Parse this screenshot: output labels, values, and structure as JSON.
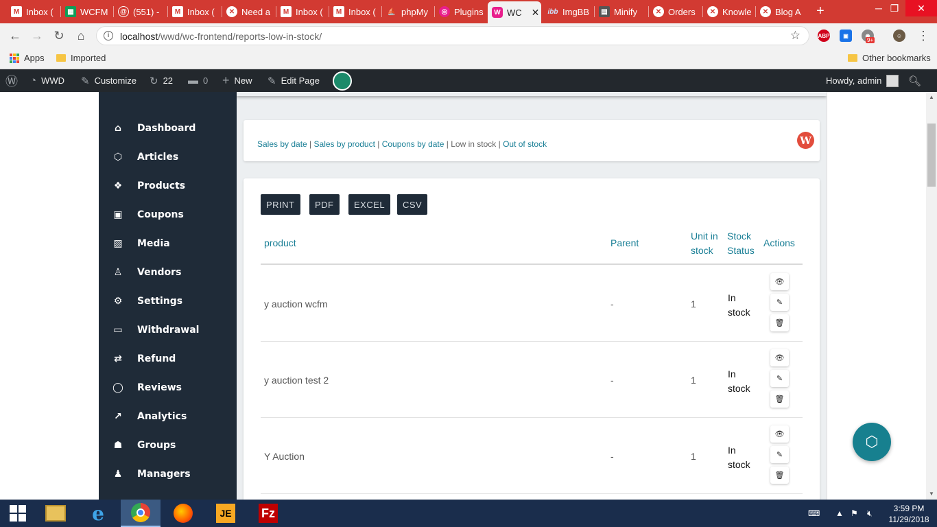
{
  "browser": {
    "tabs": [
      {
        "label": "Inbox (",
        "icon": "gmail-icon",
        "color": "#ffffff"
      },
      {
        "label": "WCFM",
        "icon": "sheets-icon",
        "color": "#0f9d58"
      },
      {
        "label": "(551) -",
        "icon": "mail-icon",
        "color": "#ffffff"
      },
      {
        "label": "Inbox (",
        "icon": "gmail-icon",
        "color": "#ffffff"
      },
      {
        "label": "Need a",
        "icon": "x-icon",
        "color": "#ffffff"
      },
      {
        "label": "Inbox (",
        "icon": "gmail-icon",
        "color": "#ffffff"
      },
      {
        "label": "Inbox (",
        "icon": "gmail-icon",
        "color": "#ffffff"
      },
      {
        "label": "phpMy",
        "icon": "phpmyadmin-icon",
        "color": "#f2a200"
      },
      {
        "label": "Plugins",
        "icon": "plugins-icon",
        "color": "#e91e8c"
      },
      {
        "label": "WC",
        "icon": "wcfm-icon",
        "color": "#e91e8c"
      },
      {
        "label": "ImgBB",
        "icon": "imgbb-icon",
        "color": "#3a8ee6"
      },
      {
        "label": "Minify",
        "icon": "minify-icon",
        "color": "#555555"
      },
      {
        "label": "Orders",
        "icon": "x-icon",
        "color": "#ffffff"
      },
      {
        "label": "Knowle",
        "icon": "x-icon",
        "color": "#ffffff"
      },
      {
        "label": "Blog A",
        "icon": "x-icon",
        "color": "#ffffff"
      }
    ],
    "url_host": "localhost",
    "url_path": "/wwd/wc-frontend/reports-low-in-stock/",
    "bookmarks": {
      "apps": "Apps",
      "imported": "Imported",
      "other": "Other bookmarks"
    },
    "ext_badge": "9+"
  },
  "adminbar": {
    "site": "WWD",
    "customize": "Customize",
    "updates": "22",
    "comments": "0",
    "new": "New",
    "edit": "Edit Page",
    "howdy": "Howdy, admin"
  },
  "sidebar": {
    "items": [
      {
        "label": "Dashboard",
        "icon": "dashboard-icon"
      },
      {
        "label": "Articles",
        "icon": "articles-icon"
      },
      {
        "label": "Products",
        "icon": "products-icon"
      },
      {
        "label": "Coupons",
        "icon": "coupons-icon"
      },
      {
        "label": "Media",
        "icon": "media-icon"
      },
      {
        "label": "Vendors",
        "icon": "vendors-icon"
      },
      {
        "label": "Settings",
        "icon": "settings-icon"
      },
      {
        "label": "Withdrawal",
        "icon": "withdrawal-icon"
      },
      {
        "label": "Refund",
        "icon": "refund-icon"
      },
      {
        "label": "Reviews",
        "icon": "reviews-icon"
      },
      {
        "label": "Analytics",
        "icon": "analytics-icon"
      },
      {
        "label": "Groups",
        "icon": "groups-icon"
      },
      {
        "label": "Managers",
        "icon": "managers-icon"
      }
    ]
  },
  "reports": {
    "links": [
      "Sales by date",
      "Sales by product",
      "Coupons by date",
      "Low in stock",
      "Out of stock"
    ],
    "active": "Low in stock"
  },
  "export_buttons": [
    "PRINT",
    "PDF",
    "EXCEL",
    "CSV"
  ],
  "table": {
    "headers": {
      "product": "product",
      "parent": "Parent",
      "unit_1": "Unit in",
      "unit_2": "stock",
      "status_1": "Stock",
      "status_2": "Status",
      "actions": "Actions"
    },
    "rows": [
      {
        "product": "y auction wcfm",
        "parent": "-",
        "units": "1",
        "status_1": "In",
        "status_2": "stock"
      },
      {
        "product": "y auction test 2",
        "parent": "-",
        "units": "1",
        "status_1": "In",
        "status_2": "stock"
      },
      {
        "product": "Y Auction",
        "parent": "-",
        "units": "1",
        "status_1": "In",
        "status_2": "stock"
      }
    ]
  },
  "taskbar": {
    "time": "3:59 PM",
    "date": "11/29/2018"
  }
}
